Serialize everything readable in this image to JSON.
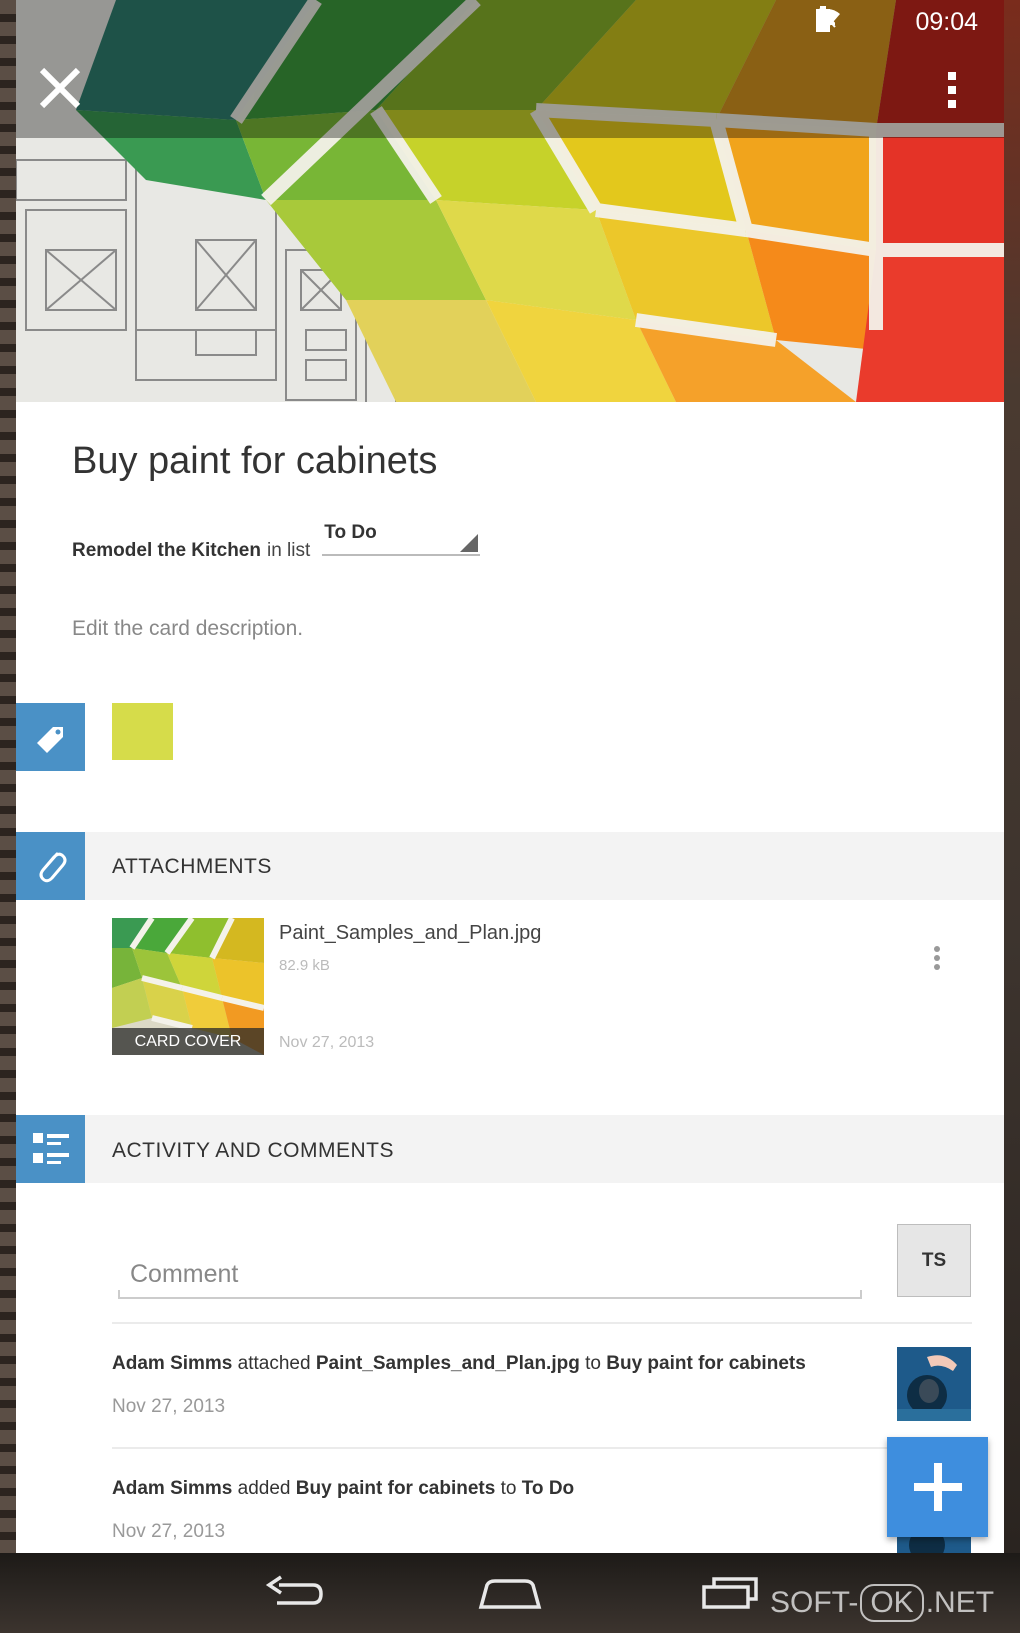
{
  "status_bar": {
    "time": "09:04",
    "icons": [
      "mute-icon",
      "wifi-icon",
      "battery-icon"
    ]
  },
  "toolbar": {
    "close_icon": "close-icon",
    "overflow_icon": "overflow-menu-icon"
  },
  "card": {
    "title": "Buy paint for cabinets",
    "board_name": "Remodel the Kitchen",
    "in_list_label": "in list",
    "list_name": "To Do",
    "description_placeholder": "Edit the card description.",
    "label_color": "#d6dc4a"
  },
  "attachments": {
    "header": "ATTACHMENTS",
    "items": [
      {
        "name": "Paint_Samples_and_Plan.jpg",
        "size": "82.9 kB",
        "date": "Nov 27, 2013",
        "badge": "CARD COVER"
      }
    ]
  },
  "activity": {
    "header": "ACTIVITY AND COMMENTS",
    "comment_placeholder": "Comment",
    "current_user_initials": "TS",
    "entries": [
      {
        "actor": "Adam Simms",
        "verb": "attached",
        "object": "Paint_Samples_and_Plan.jpg",
        "prep": "to",
        "target": "Buy paint for cabinets",
        "date": "Nov 27, 2013"
      },
      {
        "actor": "Adam Simms",
        "verb": "added",
        "object": "Buy paint for cabinets",
        "prep": "to",
        "target": "To Do",
        "date": "Nov 27, 2013"
      }
    ]
  },
  "fab": {
    "icon": "plus-icon"
  },
  "nav": {
    "buttons": [
      "back-icon",
      "home-icon",
      "recents-icon"
    ]
  },
  "watermark": {
    "part1": "SOFT-",
    "part2": "OK",
    "part3": ".NET"
  },
  "colors": {
    "accent": "#4a91c6",
    "fab": "#3e8ede",
    "label": "#d6dc4a"
  }
}
